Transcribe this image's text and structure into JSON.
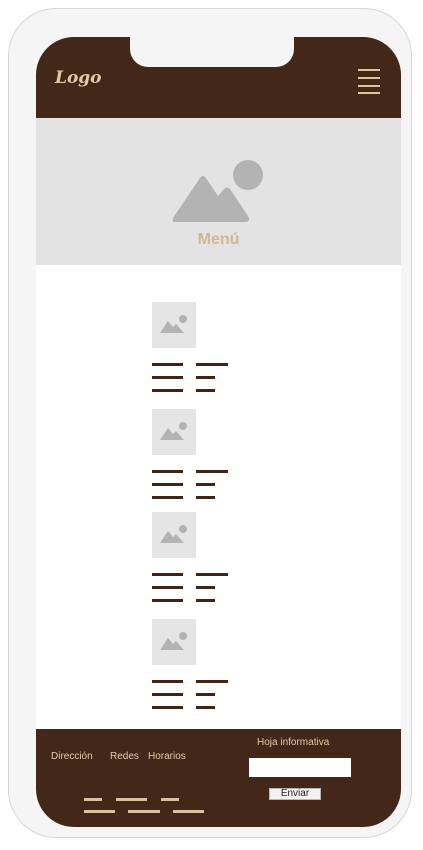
{
  "header": {
    "logo_text": "Logo",
    "menu_icon": "hamburger-menu-icon"
  },
  "hero": {
    "image_icon": "image-placeholder-icon",
    "title": "Menú"
  },
  "menu_items": [
    {
      "image_icon": "image-placeholder-icon"
    },
    {
      "image_icon": "image-placeholder-icon"
    },
    {
      "image_icon": "image-placeholder-icon"
    },
    {
      "image_icon": "image-placeholder-icon"
    }
  ],
  "footer": {
    "links": [
      "Dirección",
      "Redes",
      "Horarios"
    ],
    "newsletter_label": "Hoja informativa",
    "newsletter_input_value": "",
    "send_label": "Enviar"
  },
  "colors": {
    "brand_dark": "#43281a",
    "brand_light": "#e3c9a6",
    "placeholder_gray": "#e3e3e3"
  }
}
